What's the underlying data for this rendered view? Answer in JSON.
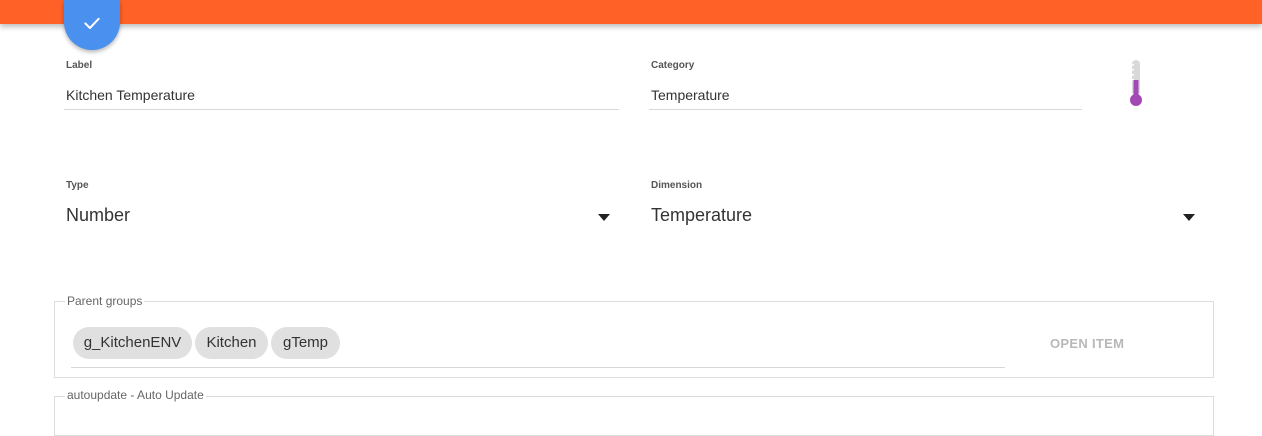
{
  "form": {
    "label": {
      "title": "Label",
      "value": "Kitchen Temperature"
    },
    "category": {
      "title": "Category",
      "value": "Temperature",
      "icon": "thermometer-icon"
    },
    "type": {
      "title": "Type",
      "value": "Number"
    },
    "dimension": {
      "title": "Dimension",
      "value": "Temperature"
    }
  },
  "parent_groups": {
    "legend": "Parent groups",
    "chips": [
      "g_KitchenENV",
      "Kitchen",
      "gTemp"
    ],
    "open_item_label": "OPEN ITEM"
  },
  "autoupdate": {
    "legend": "autoupdate - Auto Update"
  },
  "colors": {
    "header": "#ff6127",
    "save_button": "#4a90ee",
    "thermometer": "#a349b5"
  }
}
